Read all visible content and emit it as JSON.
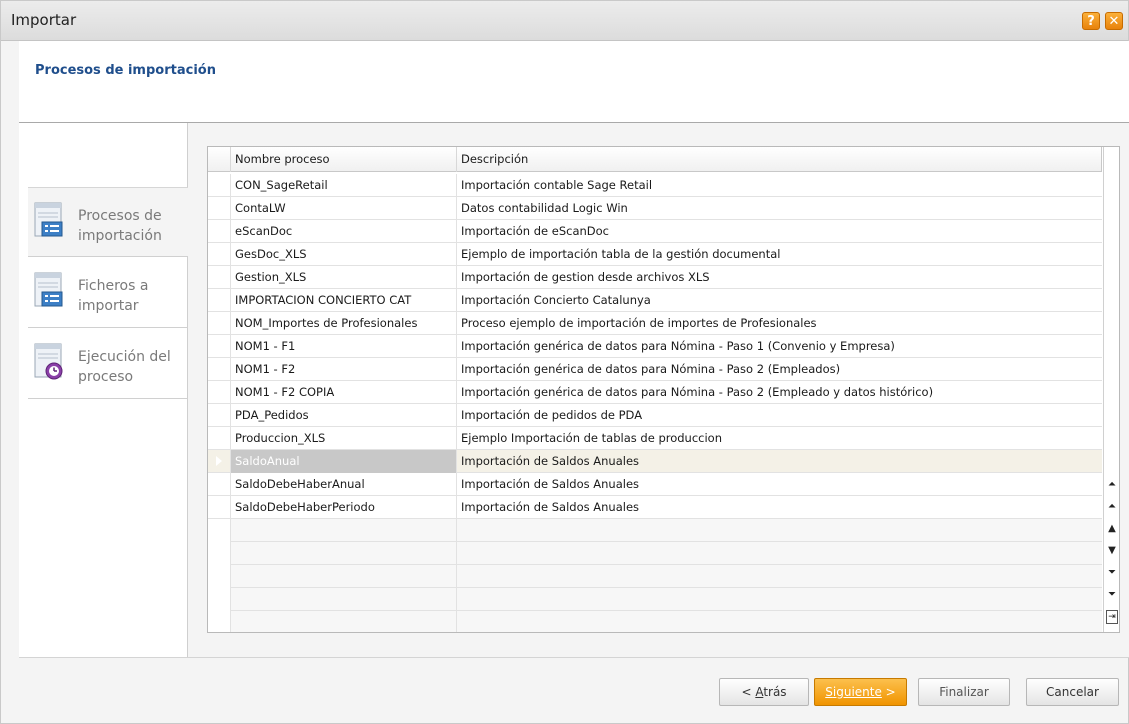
{
  "window": {
    "title": "Importar",
    "help_glyph": "?",
    "close_glyph": "✕"
  },
  "header": {
    "heading": "Procesos de importación"
  },
  "sidebar": {
    "items": [
      {
        "label": "Procesos de importación",
        "active": true
      },
      {
        "label": "Ficheros a importar",
        "active": false
      },
      {
        "label": "Ejecución del proceso",
        "active": false
      }
    ]
  },
  "grid": {
    "columns": [
      "Nombre proceso",
      "Descripción"
    ],
    "rows": [
      {
        "name": "CON_SageRetail",
        "desc": "Importación contable Sage Retail"
      },
      {
        "name": "ContaLW",
        "desc": "Datos contabilidad Logic Win"
      },
      {
        "name": "eScanDoc",
        "desc": "Importación de eScanDoc"
      },
      {
        "name": "GesDoc_XLS",
        "desc": "Ejemplo de importación tabla de la gestión documental"
      },
      {
        "name": "Gestion_XLS",
        "desc": "Importación de gestion desde archivos XLS"
      },
      {
        "name": "IMPORTACION CONCIERTO CAT",
        "desc": "Importación Concierto Catalunya"
      },
      {
        "name": "NOM_Importes de Profesionales",
        "desc": "Proceso ejemplo de importación de importes de Profesionales"
      },
      {
        "name": "NOM1 - F1",
        "desc": "Importación genérica de datos para Nómina - Paso 1 (Convenio y Empresa)"
      },
      {
        "name": "NOM1 - F2",
        "desc": "Importación genérica de datos para Nómina - Paso 2 (Empleados)"
      },
      {
        "name": "NOM1 - F2 COPIA",
        "desc": "Importación genérica de datos para Nómina - Paso 2 (Empleado y datos histórico)"
      },
      {
        "name": "PDA_Pedidos",
        "desc": "Importación de pedidos de PDA"
      },
      {
        "name": "Produccion_XLS",
        "desc": "Ejemplo Importación de tablas de produccion"
      },
      {
        "name": "SaldoAnual",
        "desc": "Importación de Saldos Anuales"
      },
      {
        "name": "SaldoDebeHaberAnual",
        "desc": "Importación de Saldos Anuales"
      },
      {
        "name": "SaldoDebeHaberPeriodo",
        "desc": "Importación de Saldos Anuales"
      }
    ],
    "selected_index": 12,
    "empty_rows": 5,
    "nav_buttons": [
      "first-icon",
      "page-up-icon",
      "up-icon",
      "down-icon",
      "page-down-icon",
      "last-icon",
      "export-icon"
    ]
  },
  "buttons": {
    "back": {
      "prefix": "< ",
      "mnemonic": "A",
      "rest": "trás"
    },
    "next": {
      "mnemonic": "S",
      "rest": "iguiente",
      "suffix": " >"
    },
    "finish": "Finalizar",
    "cancel": "Cancelar"
  },
  "colors": {
    "accent": "#f09400",
    "heading": "#1f4e8c",
    "selected_cell": "#c8c8c8"
  }
}
